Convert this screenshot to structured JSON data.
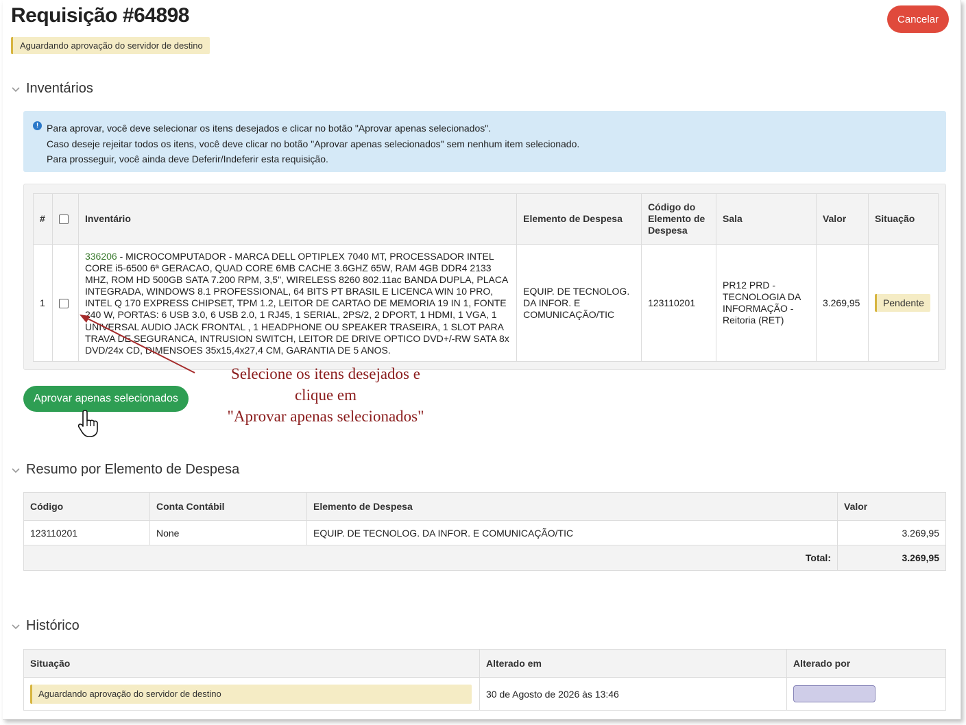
{
  "header": {
    "title": "Requisição #64898",
    "status": "Aguardando aprovação do servidor de destino",
    "cancel_label": "Cancelar"
  },
  "sections": {
    "inventarios": "Inventários",
    "resumo": "Resumo por Elemento de Despesa",
    "historico": "Histórico"
  },
  "info": {
    "line1": "Para aprovar, você deve selecionar os itens desejados e clicar no botão \"Aprovar apenas selecionados\".",
    "line2": "Caso deseje rejeitar todos os itens, você deve clicar no botão \"Aprovar apenas selecionados\" sem nenhum item selecionado.",
    "line3": "Para prosseguir, você ainda deve Deferir/Indeferir esta requisição."
  },
  "inventory_table": {
    "headers": {
      "num": "#",
      "inventario": "Inventário",
      "elemento": "Elemento de Despesa",
      "codigo": "Código do Elemento de Despesa",
      "sala": "Sala",
      "valor": "Valor",
      "situacao": "Situação"
    },
    "rows": [
      {
        "num": "1",
        "code": "336206",
        "description": " - MICROCOMPUTADOR - MARCA DELL OPTIPLEX 7040 MT, PROCESSADOR INTEL CORE i5-6500 6ª GERACAO, QUAD CORE 6MB CACHE 3.6GHZ 65W, RAM 4GB DDR4 2133 MHZ, ROM HD 500GB SATA 7.200 RPM, 3,5\", WIRELESS 8260 802.11ac BANDA DUPLA, PLACA INTEGRADA, WINDOWS 8.1 PROFESSIONAL, 64 BITS PT BRASIL E LICENCA WIN 10 PRO, INTEL Q 170 EXPRESS CHIPSET, TPM 1.2, LEITOR DE CARTAO DE MEMORIA 19 IN 1, FONTE 240 W, PORTAS: 6 USB 3.0, 6 USB 2.0, 1 RJ45, 1 SERIAL, 2PS/2, 2 DPORT, 1 HDMI, 1 VGA, 1 UNIVERSAL AUDIO JACK FRONTAL , 1 HEADPHONE OU SPEAKER TRASEIRA, 1 SLOT PARA TRAVA DE SEGURANCA, INTRUSION SWITCH, LEITOR DE DRIVE OPTICO DVD+/-RW SATA 8x DVD/24x CD, DIMENSOES 35x15,4x27,4 CM, GARANTIA DE 5 ANOS.",
        "elemento": "EQUIP. DE TECNOLOG. DA INFOR. E COMUNICAÇÃO/TIC",
        "codigo": "123110201",
        "sala": "PR12 PRD - TECNOLOGIA DA INFORMAÇÃO - Reitoria (RET)",
        "valor": "3.269,95",
        "situacao": "Pendente"
      }
    ]
  },
  "approve_label": "Aprovar apenas selecionados",
  "annotation": {
    "line1": "Selecione os itens desejados e",
    "line2": "clique em",
    "line3": "\"Aprovar apenas selecionados\""
  },
  "summary_table": {
    "headers": {
      "codigo": "Código",
      "conta": "Conta Contábil",
      "elemento": "Elemento de Despesa",
      "valor": "Valor"
    },
    "rows": [
      {
        "codigo": "123110201",
        "conta": "None",
        "elemento": "EQUIP. DE TECNOLOG. DA INFOR. E COMUNICAÇÃO/TIC",
        "valor": "3.269,95"
      }
    ],
    "total_label": "Total:",
    "total_value": "3.269,95"
  },
  "history_table": {
    "headers": {
      "situacao": "Situação",
      "alterado_em": "Alterado em",
      "alterado_por": "Alterado por"
    },
    "rows": [
      {
        "situacao": "Aguardando aprovação do servidor de destino",
        "alterado_em": "30 de Agosto de 2026 às 13:46"
      }
    ]
  },
  "colors": {
    "cancel": "#e04a3c",
    "approve": "#2e9e53",
    "info_bg": "#d5e9f7",
    "status_tag_bg": "#f5ecc5",
    "annotation": "#8b1d1d"
  }
}
